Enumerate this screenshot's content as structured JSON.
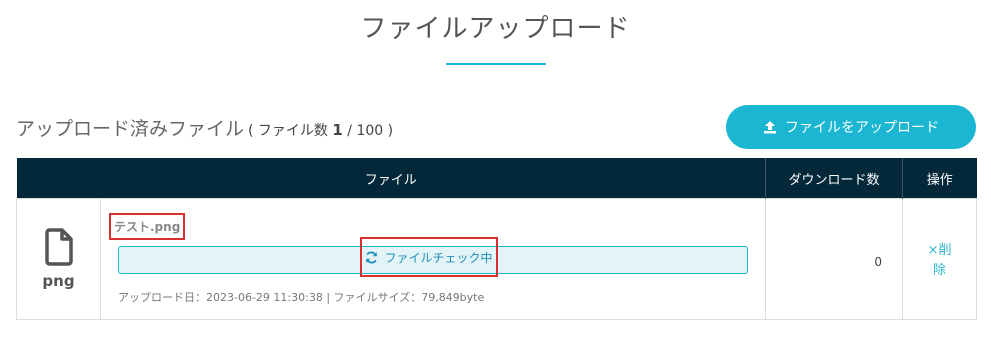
{
  "page": {
    "title": "ファイルアップロード"
  },
  "section": {
    "title": "アップロード済みファイル",
    "count_open": "( ファイル数 ",
    "count_current": "1",
    "count_sep": " / ",
    "count_max": "100",
    "count_close": " )"
  },
  "upload_button": {
    "label": "ファイルをアップロード",
    "icon": "upload-icon"
  },
  "table": {
    "headers": {
      "file": "ファイル",
      "downloads": "ダウンロード数",
      "actions": "操作"
    },
    "rows": [
      {
        "type_label": "png",
        "type_icon": "file-icon",
        "name": "テスト.png",
        "check_status": "ファイルチェック中",
        "check_icon": "refresh-icon",
        "meta": "アップロード日：2023-06-29 11:30:38 | ファイルサイズ：79,849byte",
        "downloads": "0",
        "delete_label": "×削除"
      }
    ]
  },
  "colors": {
    "accent": "#1bb6d2",
    "header_bg": "#03283a",
    "highlight_border": "#d9302f"
  }
}
